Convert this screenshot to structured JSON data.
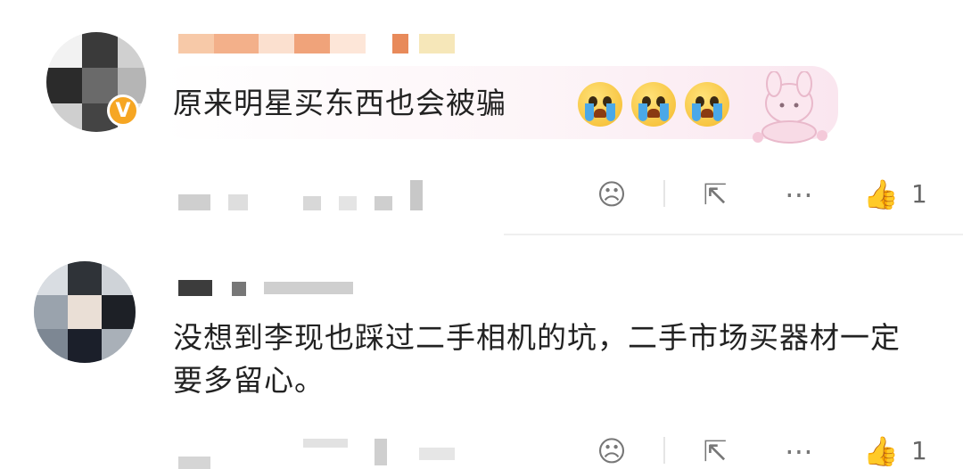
{
  "comments": [
    {
      "text": "原来明星买东西也会被骗",
      "verified_badge": "V",
      "emoji_icons": [
        "crying-face-icon",
        "crying-face-icon",
        "crying-face-icon"
      ],
      "sticker_icon": "my-melody-sticker-icon",
      "actions": {
        "dislike_icon": "☹",
        "share_icon": "⇱",
        "comment_icon": "⋯",
        "like_icon": "👍",
        "like_count": "1"
      }
    },
    {
      "text": "没想到李现也踩过二手相机的坑，二手市场买器材一定要多留心。",
      "actions": {
        "dislike_icon": "☹",
        "share_icon": "⇱",
        "comment_icon": "⋯",
        "like_icon": "👍",
        "like_count": "1"
      }
    }
  ],
  "colors": {
    "verified_badge": "#f6a623",
    "text": "#222222",
    "icon": "#777777"
  }
}
